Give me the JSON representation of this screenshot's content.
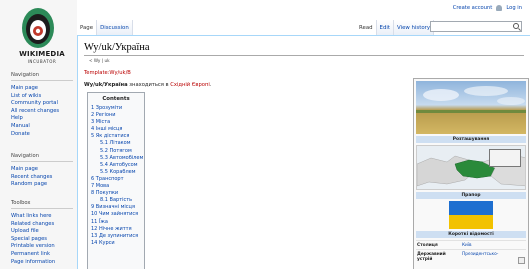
{
  "logo": {
    "word": "WIKIMEDIA",
    "sub": "INCUBATOR"
  },
  "personal": {
    "create_account": "Create account",
    "login": "Log in"
  },
  "tabs": {
    "page": "Page",
    "discussion": "Discussion",
    "read": "Read",
    "edit": "Edit",
    "history": "View history"
  },
  "sidebar": {
    "navigation": {
      "heading": "Navigation",
      "items": [
        "Main page",
        "List of wikis",
        "Community portal",
        "All recent changes",
        "Help",
        "Manual",
        "Donate"
      ]
    },
    "navigation2": {
      "heading": "Navigation",
      "items": [
        "Main page",
        "Recent changes",
        "Random page"
      ]
    },
    "toolbox": {
      "heading": "Toolbox",
      "items": [
        "What links here",
        "Related changes",
        "Upload file",
        "Special pages",
        "Printable version",
        "Permanent link",
        "Page information"
      ]
    }
  },
  "main": {
    "title": "Wy/uk/Україна",
    "subpages": "< Wy | uk",
    "template_link": "Template:Wy/uk/B",
    "intro_bold": "Wy/uk/Україна",
    "intro_text": " знаходиться в ",
    "intro_link": "Східній Європі",
    "intro_end": "."
  },
  "toc": {
    "title": "Contents",
    "items": [
      {
        "text": "1 Зрозуміти",
        "level": 1
      },
      {
        "text": "2 Регіони",
        "level": 1
      },
      {
        "text": "3 Міста",
        "level": 1
      },
      {
        "text": "4 Інші місця",
        "level": 1
      },
      {
        "text": "5 Як дістатися",
        "level": 1
      },
      {
        "text": "5.1 Літаком",
        "level": 2
      },
      {
        "text": "5.2 Потягом",
        "level": 2
      },
      {
        "text": "5.3 Автомобілем",
        "level": 2
      },
      {
        "text": "5.4 Автобусом",
        "level": 2
      },
      {
        "text": "5.5 Кораблем",
        "level": 2
      },
      {
        "text": "6 Транспорт",
        "level": 1
      },
      {
        "text": "7 Мова",
        "level": 1
      },
      {
        "text": "8 Покупки",
        "level": 1
      },
      {
        "text": "8.1 Вартість",
        "level": 2
      },
      {
        "text": "9 Визначні місця",
        "level": 1
      },
      {
        "text": "10 Чим зайнятися",
        "level": 1
      },
      {
        "text": "11 Їжа",
        "level": 1
      },
      {
        "text": "12 Нічне життя",
        "level": 1
      },
      {
        "text": "13 Де зупинитися",
        "level": 1
      },
      {
        "text": "14 Курси",
        "level": 1
      }
    ]
  },
  "infobox": {
    "location_caption": "Розташування",
    "flag_caption": "Прапор",
    "summary_caption": "Короткі відомості",
    "rows": [
      {
        "key": "Столиця",
        "value": "Київ"
      },
      {
        "key": "Державний устрій",
        "value": "Президентсько-"
      }
    ]
  },
  "colors": {
    "link": "#0645ad",
    "redlink": "#ba0000",
    "flag_blue": "#1e6fd0",
    "flag_yellow": "#f2c200"
  }
}
